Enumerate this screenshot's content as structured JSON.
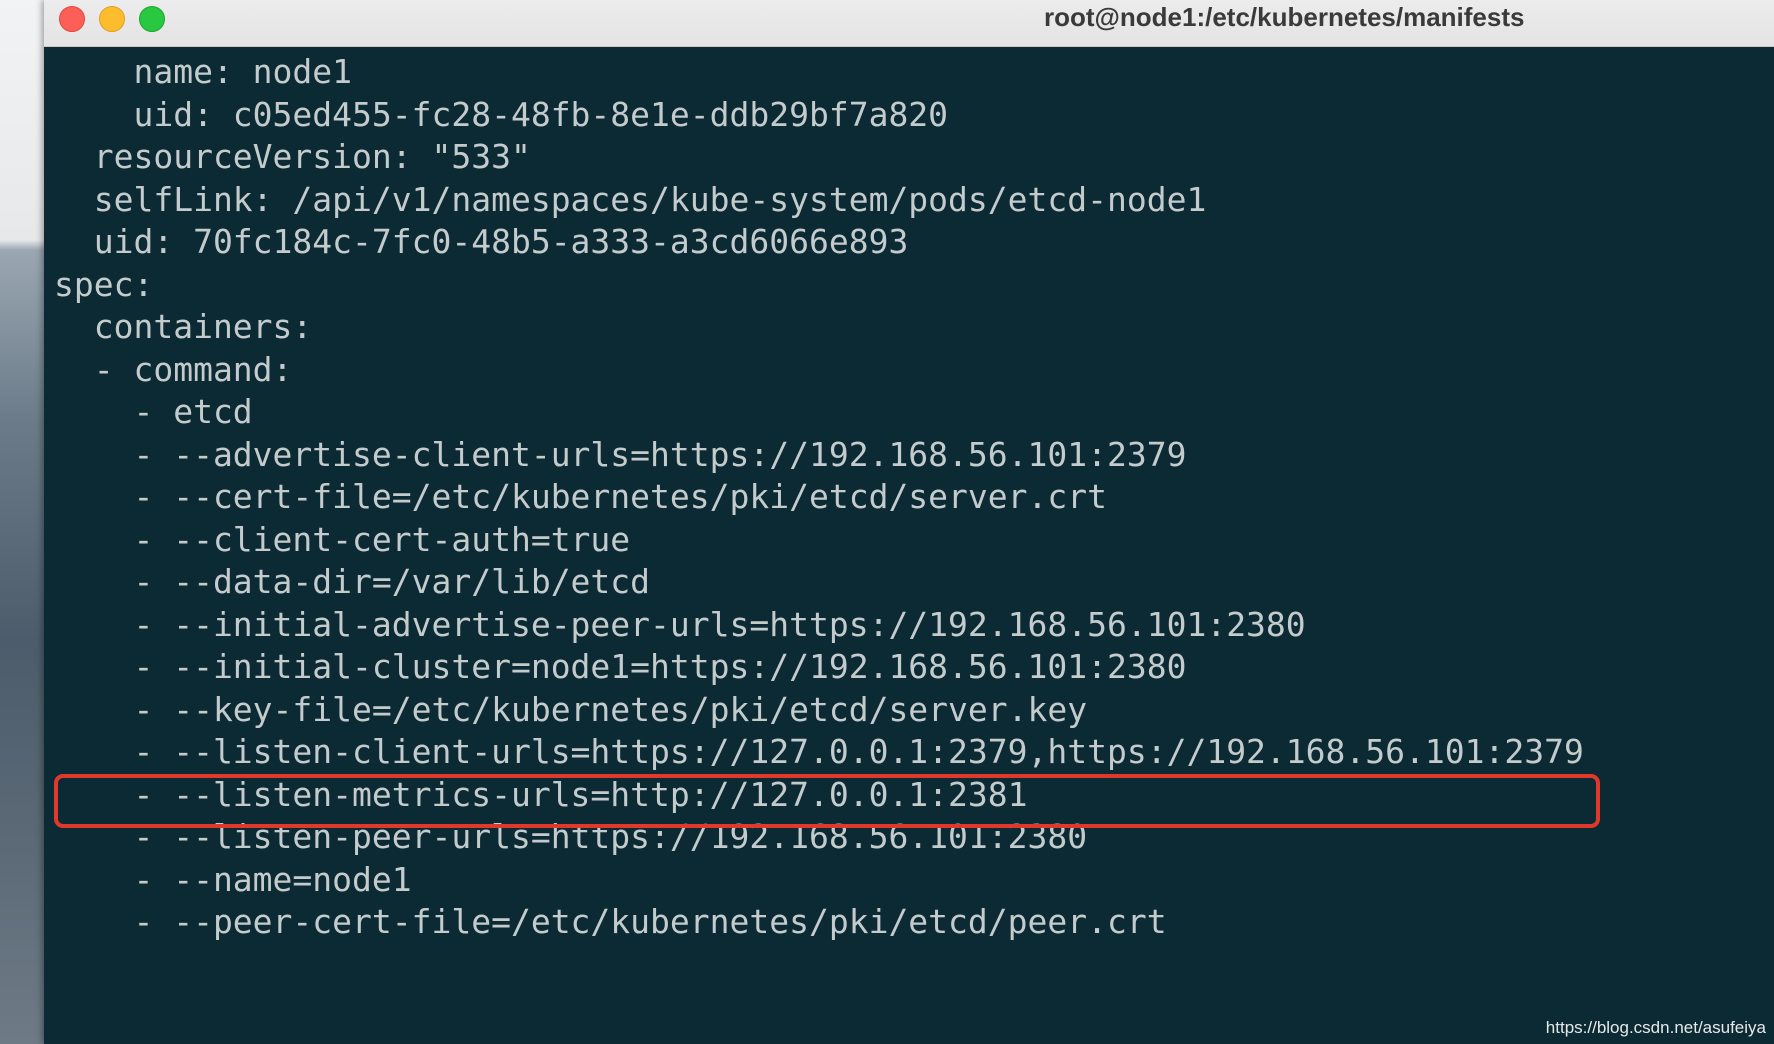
{
  "window": {
    "title": "root@node1:/etc/kubernetes/manifests"
  },
  "terminal": {
    "lines": [
      "    name: node1",
      "    uid: c05ed455-fc28-48fb-8e1e-ddb29bf7a820",
      "  resourceVersion: \"533\"",
      "  selfLink: /api/v1/namespaces/kube-system/pods/etcd-node1",
      "  uid: 70fc184c-7fc0-48b5-a333-a3cd6066e893",
      "spec:",
      "  containers:",
      "  - command:",
      "    - etcd",
      "    - --advertise-client-urls=https://192.168.56.101:2379",
      "    - --cert-file=/etc/kubernetes/pki/etcd/server.crt",
      "    - --client-cert-auth=true",
      "    - --data-dir=/var/lib/etcd",
      "    - --initial-advertise-peer-urls=https://192.168.56.101:2380",
      "    - --initial-cluster=node1=https://192.168.56.101:2380",
      "    - --key-file=/etc/kubernetes/pki/etcd/server.key",
      "    - --listen-client-urls=https://127.0.0.1:2379,https://192.168.56.101:2379",
      "    - --listen-metrics-urls=http://127.0.0.1:2381",
      "    - --listen-peer-urls=https://192.168.56.101:2380",
      "    - --name=node1",
      "    - --peer-cert-file=/etc/kubernetes/pki/etcd/peer.crt"
    ],
    "highlighted_line_index": 16,
    "text_color": "#c4cbcc",
    "background_color": "#0c2a33",
    "highlight_color": "#e0392b"
  },
  "watermark": "https://blog.csdn.net/asufeiya"
}
